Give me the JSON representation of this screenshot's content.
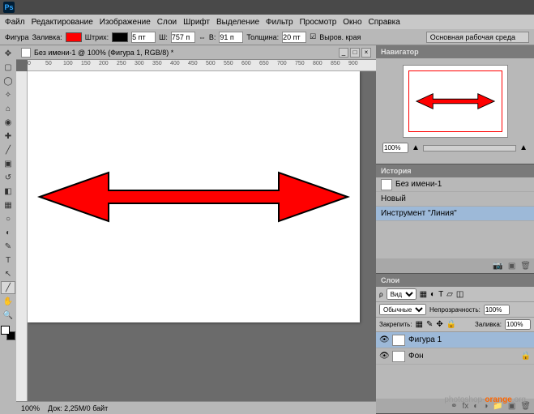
{
  "app_title": "Ps",
  "menu": [
    "Файл",
    "Редактирование",
    "Изображение",
    "Слои",
    "Шрифт",
    "Выделение",
    "Фильтр",
    "Просмотр",
    "Окно",
    "Справка"
  ],
  "options": {
    "shape_label": "Фигура",
    "fill_label": "Заливка:",
    "fill_color": "#ff0000",
    "stroke_label": "Штрих:",
    "stroke_color": "#000000",
    "stroke_width": "5 пт",
    "w_label": "Ш:",
    "w_value": "757 п",
    "h_label": "В:",
    "h_value": "91 п",
    "weight_label": "Толщина:",
    "weight_value": "20 пт",
    "align_label": "Выров. края",
    "workspace": "Основная рабочая среда"
  },
  "doc": {
    "title": "Без имени-1 @ 100% (Фигура 1, RGB/8) *",
    "zoom": "100%",
    "info": "Док: 2,25M/0 байт"
  },
  "ruler_marks": [
    "0",
    "50",
    "100",
    "150",
    "200",
    "250",
    "300",
    "350",
    "400",
    "450",
    "500",
    "550",
    "600",
    "650",
    "700",
    "750",
    "800",
    "850",
    "900"
  ],
  "navigator": {
    "title": "Навигатор",
    "zoom": "100%"
  },
  "history": {
    "title": "История",
    "doc_name": "Без имени-1",
    "items": [
      "Новый",
      "Инструмент \"Линия\""
    ]
  },
  "layers": {
    "title": "Слои",
    "kind_label": "Вид",
    "blend": "Обычные",
    "opacity_label": "Непрозрачность:",
    "opacity": "100%",
    "lock_label": "Закрепить:",
    "fill_label": "Заливка:",
    "fill": "100%",
    "items": [
      "Фигура 1",
      "Фон"
    ]
  },
  "watermark": {
    "pre": "photoshop-",
    "mid": "orange",
    "post": ".org"
  }
}
